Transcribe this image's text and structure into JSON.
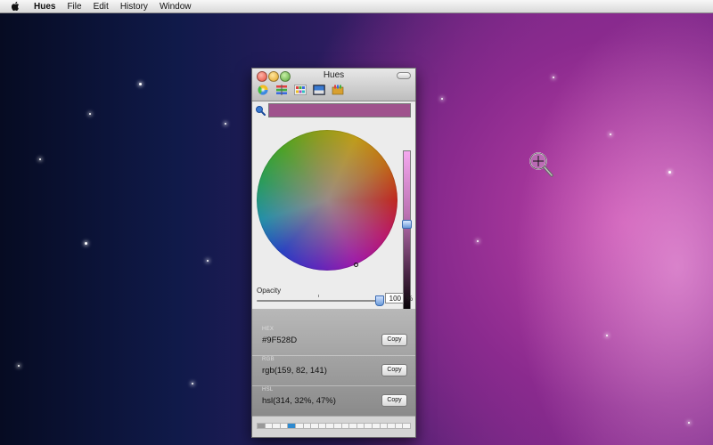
{
  "menubar": {
    "app_name": "Hues",
    "items": [
      "File",
      "Edit",
      "History",
      "Window"
    ]
  },
  "window": {
    "title": "Hues",
    "toolbar_icons": [
      "color-wheel-icon",
      "color-sliders-icon",
      "color-palette-icon",
      "image-palette-icon",
      "crayons-icon"
    ],
    "current_color_hex": "#9F528D",
    "opacity": {
      "label": "Opacity",
      "value": "100",
      "unit": "%"
    },
    "values": [
      {
        "label": "HEX",
        "value": "#9F528D",
        "button": "Copy"
      },
      {
        "label": "RGB",
        "value": "rgb(159, 82, 141)",
        "button": "Copy"
      },
      {
        "label": "HSL",
        "value": "hsl(314, 32%, 47%)",
        "button": "Copy"
      }
    ]
  }
}
